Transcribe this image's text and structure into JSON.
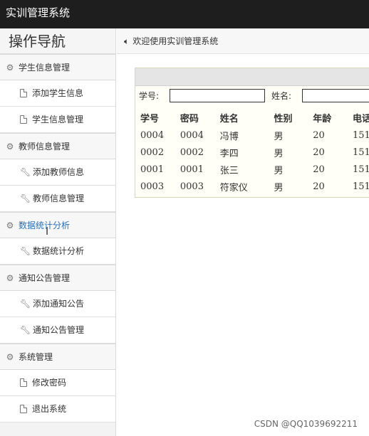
{
  "app": {
    "title": "实训管理系统"
  },
  "sidebar": {
    "title": "操作导航",
    "groups": [
      {
        "label": "学生信息管理",
        "icon": "gear-icon",
        "items": [
          {
            "label": "添加学生信息",
            "icon": "document-icon"
          },
          {
            "label": "学生信息管理",
            "icon": "document-icon"
          }
        ]
      },
      {
        "label": "教师信息管理",
        "icon": "gear-icon",
        "items": [
          {
            "label": "添加教师信息",
            "icon": "wrench-icon"
          },
          {
            "label": "教师信息管理",
            "icon": "wrench-icon"
          }
        ]
      },
      {
        "label": "数据统计分析",
        "icon": "gear-icon",
        "items": [
          {
            "label": "数据统计分析",
            "icon": "wrench-icon"
          }
        ]
      },
      {
        "label": "通知公告管理",
        "icon": "gear-icon",
        "items": [
          {
            "label": "添加通知公告",
            "icon": "wrench-icon"
          },
          {
            "label": "通知公告管理",
            "icon": "wrench-icon"
          }
        ]
      },
      {
        "label": "系统管理",
        "icon": "gear-icon",
        "items": [
          {
            "label": "修改密码",
            "icon": "document-icon"
          },
          {
            "label": "退出系统",
            "icon": "document-icon"
          }
        ]
      }
    ]
  },
  "main": {
    "welcome": "欢迎使用实训管理系统",
    "search": {
      "student_id_label": "学号:",
      "student_id_value": "",
      "name_label": "姓名:",
      "name_value": ""
    },
    "table": {
      "columns": [
        "学号",
        "密码",
        "姓名",
        "性别",
        "年龄",
        "电话"
      ],
      "rows": [
        [
          "0004",
          "0004",
          "冯博",
          "男",
          "20",
          "151"
        ],
        [
          "0002",
          "0002",
          "李四",
          "男",
          "20",
          "151"
        ],
        [
          "0001",
          "0001",
          "张三",
          "男",
          "20",
          "151"
        ],
        [
          "0003",
          "0003",
          "符家仪",
          "男",
          "20",
          "151"
        ]
      ]
    }
  },
  "watermark": "CSDN @QQ1039692211",
  "colors": {
    "topbar": "#1e1e1e",
    "active_link": "#2a6fb8",
    "panel_border": "#d7d7b8"
  }
}
